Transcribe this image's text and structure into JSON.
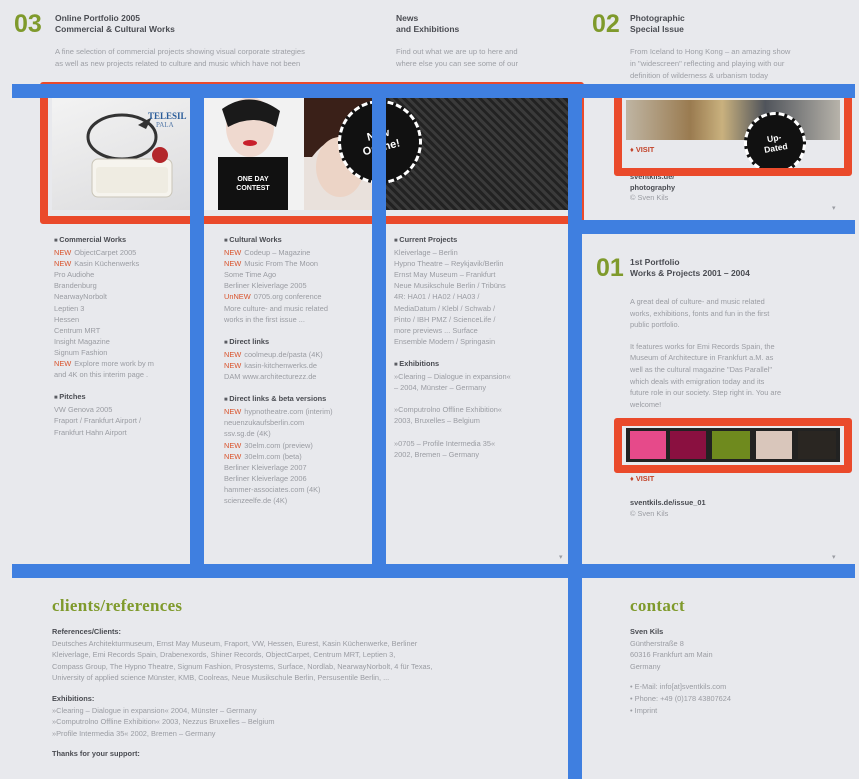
{
  "sections": {
    "s03": {
      "num": "03",
      "title_line1": "Online Portfolio 2005",
      "title_line2": "Commercial & Cultural Works",
      "intro1": "A fine selection of commercial projects showing visual corporate strategies",
      "intro2": "as well as new projects related to culture and music which have not been"
    },
    "news": {
      "title_line1": "News",
      "title_line2": "and Exhibitions",
      "intro1": "Find out what we are up to here and",
      "intro2": "where else you can see some of our"
    },
    "s02": {
      "num": "02",
      "title_line1": "Photographic",
      "title_line2": "Special Issue",
      "intro1": "From Iceland to Hong Kong – an amazing show",
      "intro2": "in \"widescreen\" reflecting and playing with our",
      "intro3": "definition of wilderness & urbanism today",
      "visit": "♦ VISIT",
      "badge": "Up-Dated",
      "link": "sventkils.de/",
      "link2": "photography",
      "copy": "© Sven Kils"
    },
    "s01": {
      "num": "01",
      "title_line1": "1st Portfolio",
      "title_line2": "Works & Projects 2001 – 2004",
      "p1": [
        "A great deal of culture- and music related",
        "works, exhibitions, fonts and fun in the first",
        "public portfolio."
      ],
      "p2": [
        "It features works for Emi Records Spain, the",
        "Museum of Architecture in Frankfurt a.M. as",
        "well as the cultural magazine \"Das Parallel\"",
        "which deals with emigration today and its",
        "future role in our society. Step right in. You are",
        "welcome!"
      ],
      "visit": "♦ VISIT",
      "link": "sventkils.de/issue_01",
      "copy": "© Sven Kils"
    }
  },
  "banner": {
    "bag_brand": "TELESIL",
    "bag_sub": "PALA",
    "stamp_text": "New Online!",
    "oneday_text": "ONE DAY CONTEST"
  },
  "columns": {
    "commercial": {
      "heading": "Commercial Works",
      "rows": [
        {
          "new": "NEW",
          "text": "ObjectCarpet 2005"
        },
        {
          "new": "NEW",
          "text": "Kasin Küchenwerks"
        },
        {
          "new": "",
          "text": "Pro Audiohe"
        },
        {
          "new": "",
          "text": "Brandenburg"
        },
        {
          "new": "",
          "text": "NearwayNorbolt"
        },
        {
          "new": "",
          "text": "Leptien 3"
        },
        {
          "new": "",
          "text": "Hessen"
        },
        {
          "new": "",
          "text": "Centrum MRT"
        },
        {
          "new": "",
          "text": "Insight Magazine"
        },
        {
          "new": "",
          "text": "Signum Fashion"
        },
        {
          "new": "NEW",
          "text": "Explore more work by m"
        },
        {
          "new": "",
          "text": "and 4K on this interim page ."
        }
      ],
      "heading2": "Pitches",
      "rows2": [
        "VW Genova 2005",
        "Fraport / Frankfurt Airport /",
        "Frankfurt Hahn Airport"
      ]
    },
    "cultural": {
      "heading": "Cultural Works",
      "rows": [
        {
          "new": "NEW",
          "text": "Codeup – Magazine"
        },
        {
          "new": "NEW",
          "text": "Music From The Moon"
        },
        {
          "new": "",
          "text": "Some Time Ago"
        },
        {
          "new": "",
          "text": "Berliner Kleiverlage 2005"
        },
        {
          "new": "UnNEW",
          "text": "0705.org conference"
        },
        {
          "new": "",
          "text": "More culture- and music related"
        },
        {
          "new": "",
          "text": "works in the first issue ..."
        }
      ],
      "heading2": "Direct links",
      "rows2": [
        {
          "new": "NEW",
          "text": "coolmeup.de/pasta (4K)"
        },
        {
          "new": "NEW",
          "text": "kasin-kitchenwerks.de"
        },
        {
          "new": "",
          "text": "DAM www.architecturezz.de"
        }
      ],
      "heading3": "Direct links & beta versions",
      "rows3": [
        {
          "new": "NEW",
          "text": "hypnotheatre.com (interim)"
        },
        {
          "new": "",
          "text": "neuenzukaufsberlin.com"
        },
        {
          "new": "",
          "text": "ssv.sg.de (4K)"
        },
        {
          "new": "NEW",
          "text": "30elm.com (preview)"
        },
        {
          "new": "NEW",
          "text": "30elm.com (beta)"
        },
        {
          "new": "",
          "text": "Berliner Kleiverlage 2007"
        },
        {
          "new": "",
          "text": "Berliner Kleiverlage 2006"
        },
        {
          "new": "",
          "text": "hammer-associates.com (4K)"
        },
        {
          "new": "",
          "text": "scienzeelfe.de (4K)"
        }
      ]
    },
    "projects": {
      "heading": "Current Projects",
      "rows": [
        "Kleiverlage – Berlin",
        "Hypno Theatre – Reykjavik/Berlin",
        "Ernst May Museum – Frankfurt",
        "Neue Musikschule Berlin / Tribüns",
        "4R: HA01 / HA02 / HA03 /",
        "MediaDatum / Klebl / Schwab /",
        "Pinto / IBH PMZ / ScienceLife /",
        "more previews ... Surface",
        "Ensemble Modern / Springasin"
      ],
      "heading2": "Exhibitions",
      "rows2": [
        "»Clearing – Dialogue in expansion«",
        "– 2004, Münster – Germany",
        "",
        "»Computrolno Offline Exhibition«",
        "2003, Bruxelles – Belgium",
        "",
        "»0705 – Profile Intermedia 35«",
        "2002, Bremen – Germany"
      ]
    }
  },
  "clients": {
    "heading": "clients/references",
    "sub": "References/Clients:",
    "lines": [
      "Deutsches Architekturmuseum, Ernst May Museum, Fraport, VW, Hessen, Eurest, Kasin Küchenwerke, Berliner",
      "Kleiverlage, Emi Records Spain, Drabenexords, Shiner Records, ObjectCarpet, Centrum MRT, Leptien 3,",
      "Compass Group, The Hypno Theatre, Signum Fashion, Prosystems, Surface, Nordlab, NearwayNorbolt, 4 für Texas,",
      "University of applied science Münster, KMB, Coolreas, Neue Musikschule Berlin, Persusentile Berlin, ..."
    ],
    "sub2": "Exhibitions:",
    "lines2": [
      "»Clearing – Dialogue in expansion« 2004, Münster – Germany",
      "»Computrolno Offline Exhibition« 2003, Nezzus Bruxelles – Belgium",
      "»Profile Intermedia 35« 2002, Bremen – Germany"
    ],
    "sub3": "Thanks for your support:"
  },
  "contact": {
    "heading": "contact",
    "name": "Sven Kils",
    "addr": [
      "Güntherstraße 8",
      "60316 Frankfurt am Main",
      "Germany"
    ],
    "links": [
      "• E-Mail: info[at]sventkils.com",
      "• Phone: +49 (0)178 43807624",
      "• Imprint"
    ]
  },
  "colors": {
    "grid_blue": "#3f7fe0",
    "highlight_red": "#ea4a2b",
    "accent_green": "#7f9a2c",
    "new_red": "#d9532c"
  }
}
